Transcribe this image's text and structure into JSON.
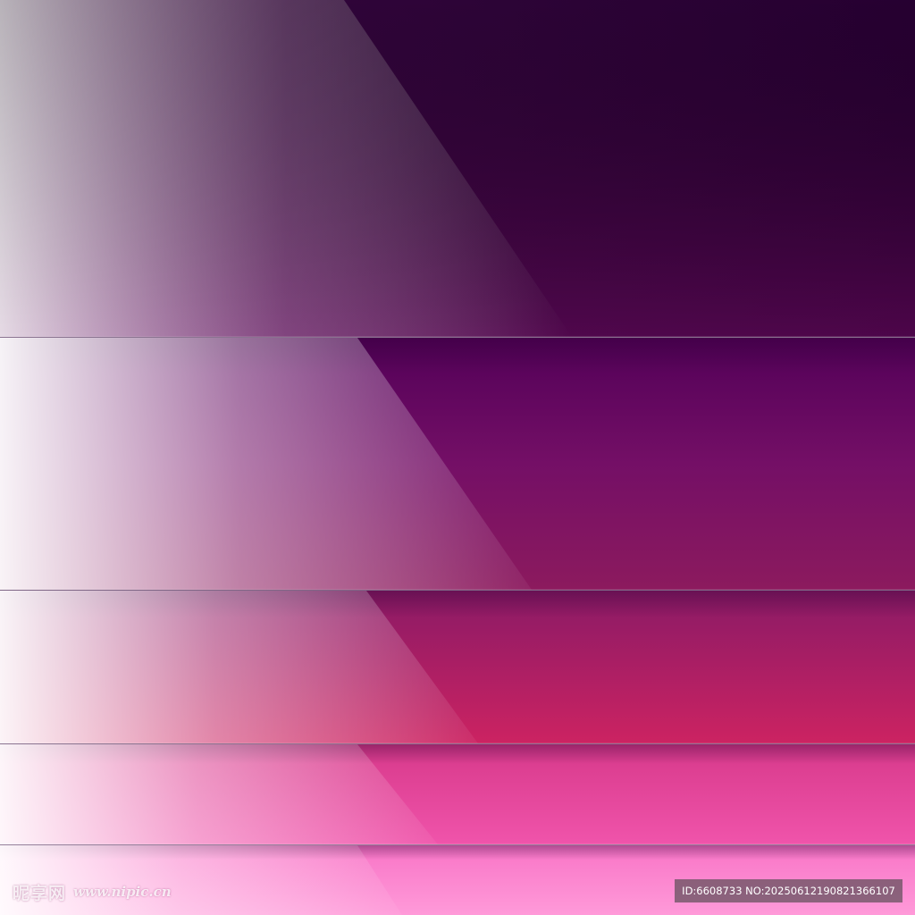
{
  "image": {
    "description_colors": {
      "top_dark": "#2e0038",
      "mid_purple": "#6a0a62",
      "mid_magenta": "#b0175e",
      "lower_pink": "#e9479d",
      "bottom_pink": "#ff8fd6",
      "highlight": "#ffffff"
    }
  },
  "watermark": {
    "brand": "昵享网",
    "site": "www.nipic.cn",
    "id_label": "ID:6608733 NO:20250612190821366107"
  }
}
